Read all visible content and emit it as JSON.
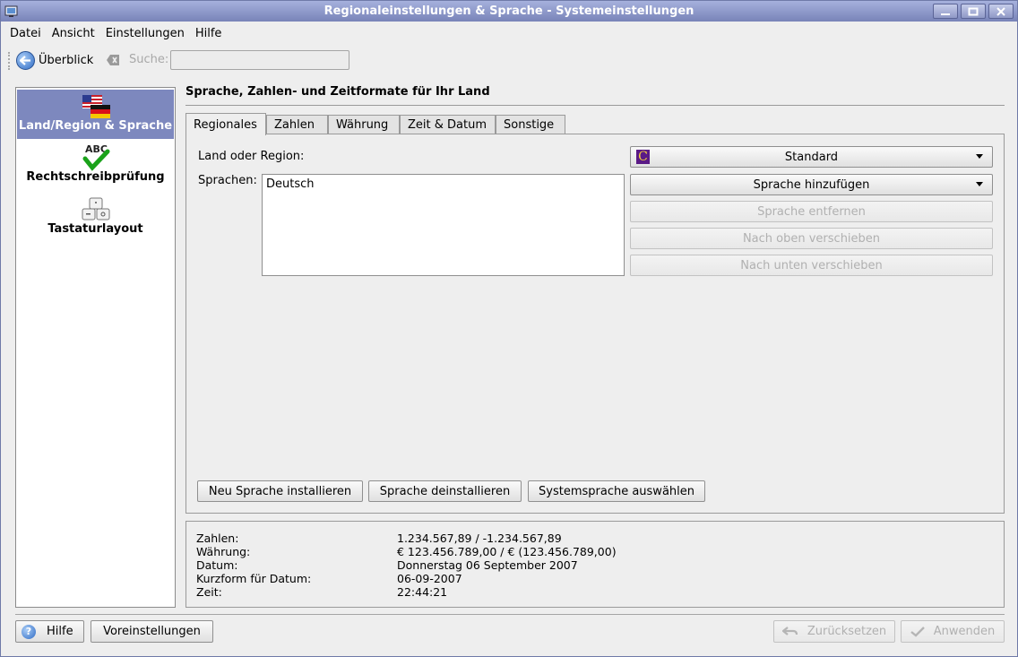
{
  "window": {
    "title": "Regionaleinstellungen & Sprache - Systemeinstellungen"
  },
  "menu": [
    "Datei",
    "Ansicht",
    "Einstellungen",
    "Hilfe"
  ],
  "toolbar": {
    "overview_label": "Überblick",
    "search_label": "Suche:",
    "search_value": ""
  },
  "sidebar": {
    "items": [
      {
        "label": "Land/Region & Sprache",
        "icon": "flags-icon",
        "active": true
      },
      {
        "label": "Rechtschreibprüfung",
        "icon": "spellcheck-icon",
        "active": false
      },
      {
        "label": "Tastaturlayout",
        "icon": "keyboard-icon",
        "active": false
      }
    ]
  },
  "main": {
    "heading": "Sprache, Zahlen- und Zeitformate für Ihr Land",
    "tabs": [
      "Regionales",
      "Zahlen",
      "Währung",
      "Zeit & Datum",
      "Sonstige"
    ],
    "country_label": "Land oder Region:",
    "country_value": "Standard",
    "languages_label": "Sprachen:",
    "languages": [
      "Deutsch"
    ],
    "add_language": "Sprache hinzufügen",
    "remove_language": "Sprache entfernen",
    "move_up": "Nach oben verschieben",
    "move_down": "Nach unten verschieben",
    "install_language": "Neu Sprache installieren",
    "uninstall_language": "Sprache deinstallieren",
    "choose_system_language": "Systemsprache auswählen"
  },
  "summary": {
    "rows": [
      {
        "label": "Zahlen:",
        "value": "1.234.567,89 / -1.234.567,89"
      },
      {
        "label": "Währung:",
        "value": "€ 123.456.789,00 / € (123.456.789,00)"
      },
      {
        "label": "Datum:",
        "value": "Donnerstag 06 September 2007"
      },
      {
        "label": "Kurzform für Datum:",
        "value": "06-09-2007"
      },
      {
        "label": "Zeit:",
        "value": "22:44:21"
      }
    ]
  },
  "footer": {
    "help": "Hilfe",
    "defaults": "Voreinstellungen",
    "reset": "Zurücksetzen",
    "apply": "Anwenden"
  },
  "colors": {
    "titlebar": "#7883b8",
    "selection": "#7d88be"
  }
}
